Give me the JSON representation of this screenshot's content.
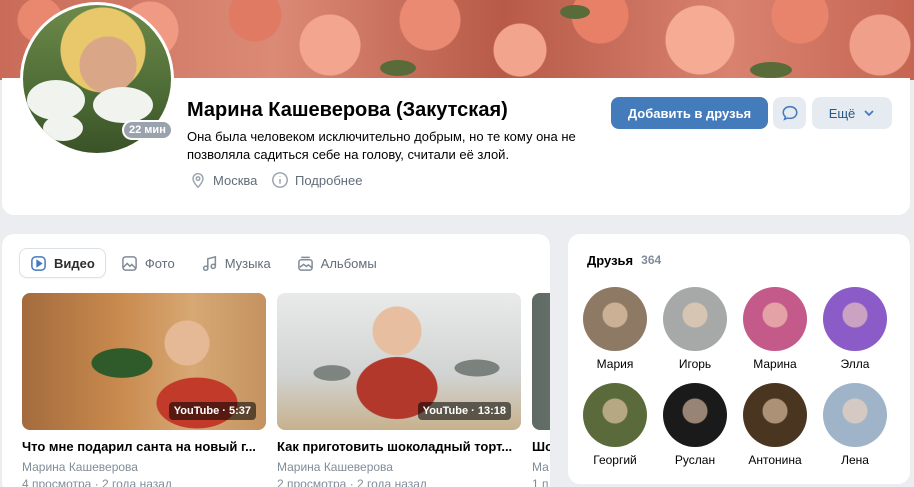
{
  "profile": {
    "name": "Марина Кашеверова (Закутская)",
    "online": "22 мин",
    "status": "Она была человеком исключительно добрым, но те кому она не позволяла садиться себе на голову, считали её злой.",
    "city": "Москва",
    "more_info": "Подробнее",
    "add_friend": "Добавить в друзья",
    "more": "Ещё"
  },
  "tabs": [
    {
      "label": "Видео",
      "icon": "video-icon"
    },
    {
      "label": "Фото",
      "icon": "photo-icon"
    },
    {
      "label": "Музыка",
      "icon": "music-icon"
    },
    {
      "label": "Альбомы",
      "icon": "album-icon"
    }
  ],
  "videos": [
    {
      "title": "Что мне подарил санта на новый г...",
      "duration": "YouTube · 5:37",
      "author": "Марина Кашеверова",
      "stats": "4 просмотра · 2 года назад"
    },
    {
      "title": "Как приготовить шоколадный торт...",
      "duration": "YouTube · 13:18",
      "author": "Марина Кашеверова",
      "stats": "2 просмотра · 2 года назад"
    },
    {
      "title": "Шо",
      "duration": "",
      "author": "Ма",
      "stats": "1 п"
    }
  ],
  "friends": {
    "title": "Друзья",
    "count": "364",
    "list": [
      {
        "name": "Мария",
        "color": "#8e7a64"
      },
      {
        "name": "Игорь",
        "color": "#a7a9a8"
      },
      {
        "name": "Марина",
        "color": "#c45a8a"
      },
      {
        "name": "Элла",
        "color": "#8b5cc7"
      },
      {
        "name": "Георгий",
        "color": "#5b6a3a"
      },
      {
        "name": "Руслан",
        "color": "#1a1a1a"
      },
      {
        "name": "Антонина",
        "color": "#4a3620"
      },
      {
        "name": "Лена",
        "color": "#9fb3c9"
      }
    ]
  },
  "colors": {
    "accent": "#447bba",
    "link": "#2a5885",
    "muted": "#818c99"
  }
}
